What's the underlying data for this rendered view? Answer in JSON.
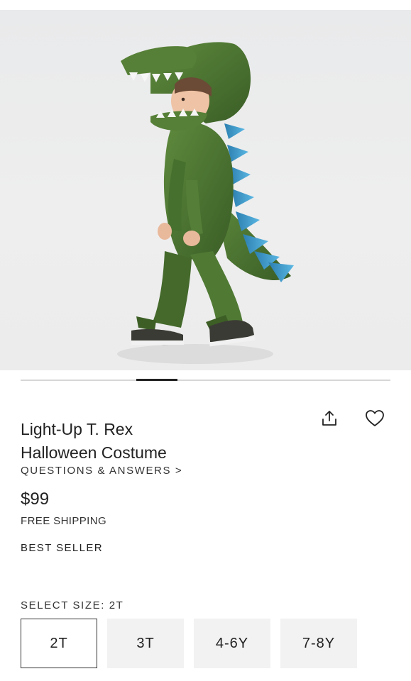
{
  "product": {
    "title_line1": "Light-Up T. Rex",
    "title_line2": "Halloween Costume",
    "qa_link": "QUESTIONS & ANSWERS >",
    "price": "$99",
    "shipping": "FREE SHIPPING",
    "badge": "BEST SELLER"
  },
  "gallery": {
    "image_subject": "Toddler in a green T. Rex costume with blue spikes",
    "active_index": 2,
    "count": 9
  },
  "actions": {
    "share_icon": "share-icon",
    "favorite_icon": "heart-icon"
  },
  "size": {
    "label": "SELECT SIZE: 2T",
    "selected": "2T",
    "options": [
      "2T",
      "3T",
      "4-6Y",
      "7-8Y"
    ]
  },
  "colors": {
    "text": "#222222",
    "option_bg": "#f2f2f2",
    "selected_border": "#333333",
    "costume_green": "#4e7a35",
    "spike_blue": "#3f9fd1"
  }
}
